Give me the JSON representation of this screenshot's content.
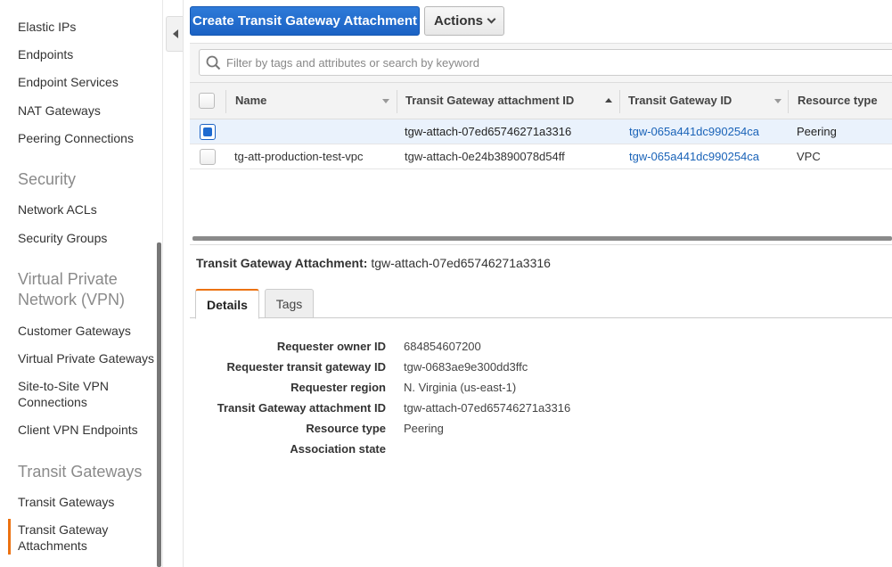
{
  "sidebar": {
    "items": [
      {
        "label": "Elastic IPs"
      },
      {
        "label": "Endpoints"
      },
      {
        "label": "Endpoint Services"
      },
      {
        "label": "NAT Gateways"
      },
      {
        "label": "Peering Connections"
      }
    ],
    "security": {
      "heading": "Security",
      "items": [
        {
          "label": "Network ACLs"
        },
        {
          "label": "Security Groups"
        }
      ]
    },
    "vpn": {
      "heading": "Virtual Private Network (VPN)",
      "items": [
        {
          "label": "Customer Gateways"
        },
        {
          "label": "Virtual Private Gateways"
        },
        {
          "label": "Site-to-Site VPN Connections"
        },
        {
          "label": "Client VPN Endpoints"
        }
      ]
    },
    "transit": {
      "heading": "Transit Gateways",
      "items": [
        {
          "label": "Transit Gateways"
        },
        {
          "label": "Transit Gateway Attachments"
        }
      ]
    },
    "active_color": "#ec7211"
  },
  "toolbar": {
    "create_label": "Create Transit Gateway Attachment",
    "actions_label": "Actions"
  },
  "search": {
    "placeholder": "Filter by tags and attributes or search by keyword"
  },
  "table": {
    "columns": [
      "Name",
      "Transit Gateway attachment ID",
      "Transit Gateway ID",
      "Resource type"
    ],
    "rows": [
      {
        "selected": true,
        "name": "",
        "attachment_id": "tgw-attach-07ed65746271a3316",
        "tgw_id": "tgw-065a441dc990254ca",
        "resource_type": "Peering"
      },
      {
        "selected": false,
        "name": "tg-att-production-test-vpc",
        "attachment_id": "tgw-attach-0e24b3890078d54ff",
        "tgw_id": "tgw-065a441dc990254ca",
        "resource_type": "VPC"
      }
    ]
  },
  "detail": {
    "title_label": "Transit Gateway Attachment:",
    "title_value": "tgw-attach-07ed65746271a3316",
    "tabs": [
      "Details",
      "Tags"
    ],
    "fields": [
      {
        "label": "Requester owner ID",
        "value": "684854607200"
      },
      {
        "label": "Requester transit gateway ID",
        "value": "tgw-0683ae9e300dd3ffc"
      },
      {
        "label": "Requester region",
        "value": "N. Virginia (us-east-1)"
      },
      {
        "label": "Transit Gateway attachment ID",
        "value": "tgw-attach-07ed65746271a3316"
      },
      {
        "label": "Resource type",
        "value": "Peering"
      },
      {
        "label": "Association state",
        "value": ""
      }
    ]
  },
  "colors": {
    "primary": "#1b62c4",
    "link": "#1a63b8",
    "accent": "#ec7211"
  }
}
